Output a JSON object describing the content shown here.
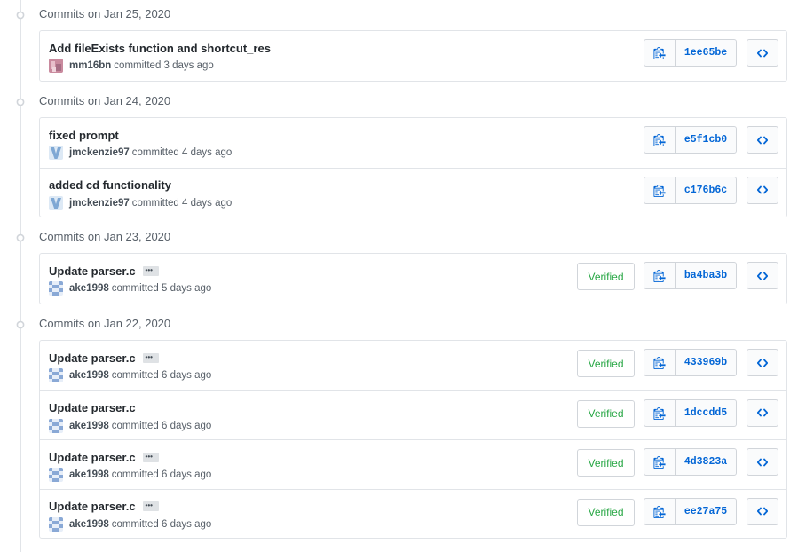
{
  "groups": [
    {
      "date": "Commits on Jan 25, 2020",
      "commits": [
        {
          "message": "Add fileExists function and shortcut_res",
          "author": "mm16bn",
          "time": "committed 3 days ago",
          "sha": "1ee65be",
          "verified": null,
          "ellipsis": false,
          "avatar": "pink"
        }
      ]
    },
    {
      "date": "Commits on Jan 24, 2020",
      "commits": [
        {
          "message": "fixed prompt",
          "author": "jmckenzie97",
          "time": "committed 4 days ago",
          "sha": "e5f1cb0",
          "verified": null,
          "ellipsis": false,
          "avatar": "blue-v"
        },
        {
          "message": "added cd functionality",
          "author": "jmckenzie97",
          "time": "committed 4 days ago",
          "sha": "c176b6c",
          "verified": null,
          "ellipsis": false,
          "avatar": "blue-v"
        }
      ]
    },
    {
      "date": "Commits on Jan 23, 2020",
      "commits": [
        {
          "message": "Update parser.c",
          "author": "ake1998",
          "time": "committed 5 days ago",
          "sha": "ba4ba3b",
          "verified": "Verified",
          "ellipsis": true,
          "avatar": "pixel"
        }
      ]
    },
    {
      "date": "Commits on Jan 22, 2020",
      "commits": [
        {
          "message": "Update parser.c",
          "author": "ake1998",
          "time": "committed 6 days ago",
          "sha": "433969b",
          "verified": "Verified",
          "ellipsis": true,
          "avatar": "pixel"
        },
        {
          "message": "Update parser.c",
          "author": "ake1998",
          "time": "committed 6 days ago",
          "sha": "1dccdd5",
          "verified": "Verified",
          "ellipsis": false,
          "avatar": "pixel"
        },
        {
          "message": "Update parser.c",
          "author": "ake1998",
          "time": "committed 6 days ago",
          "sha": "4d3823a",
          "verified": "Verified",
          "ellipsis": true,
          "avatar": "pixel"
        },
        {
          "message": "Update parser.c",
          "author": "ake1998",
          "time": "committed 6 days ago",
          "sha": "ee27a75",
          "verified": "Verified",
          "ellipsis": true,
          "avatar": "pixel"
        }
      ]
    }
  ],
  "icons": {
    "copy": "clippy-icon",
    "browse": "code-icon",
    "node": "commit-node-icon"
  },
  "colors": {
    "link": "#0366d6",
    "verified": "#28a745",
    "border": "#e1e4e8",
    "muted": "#586069"
  }
}
